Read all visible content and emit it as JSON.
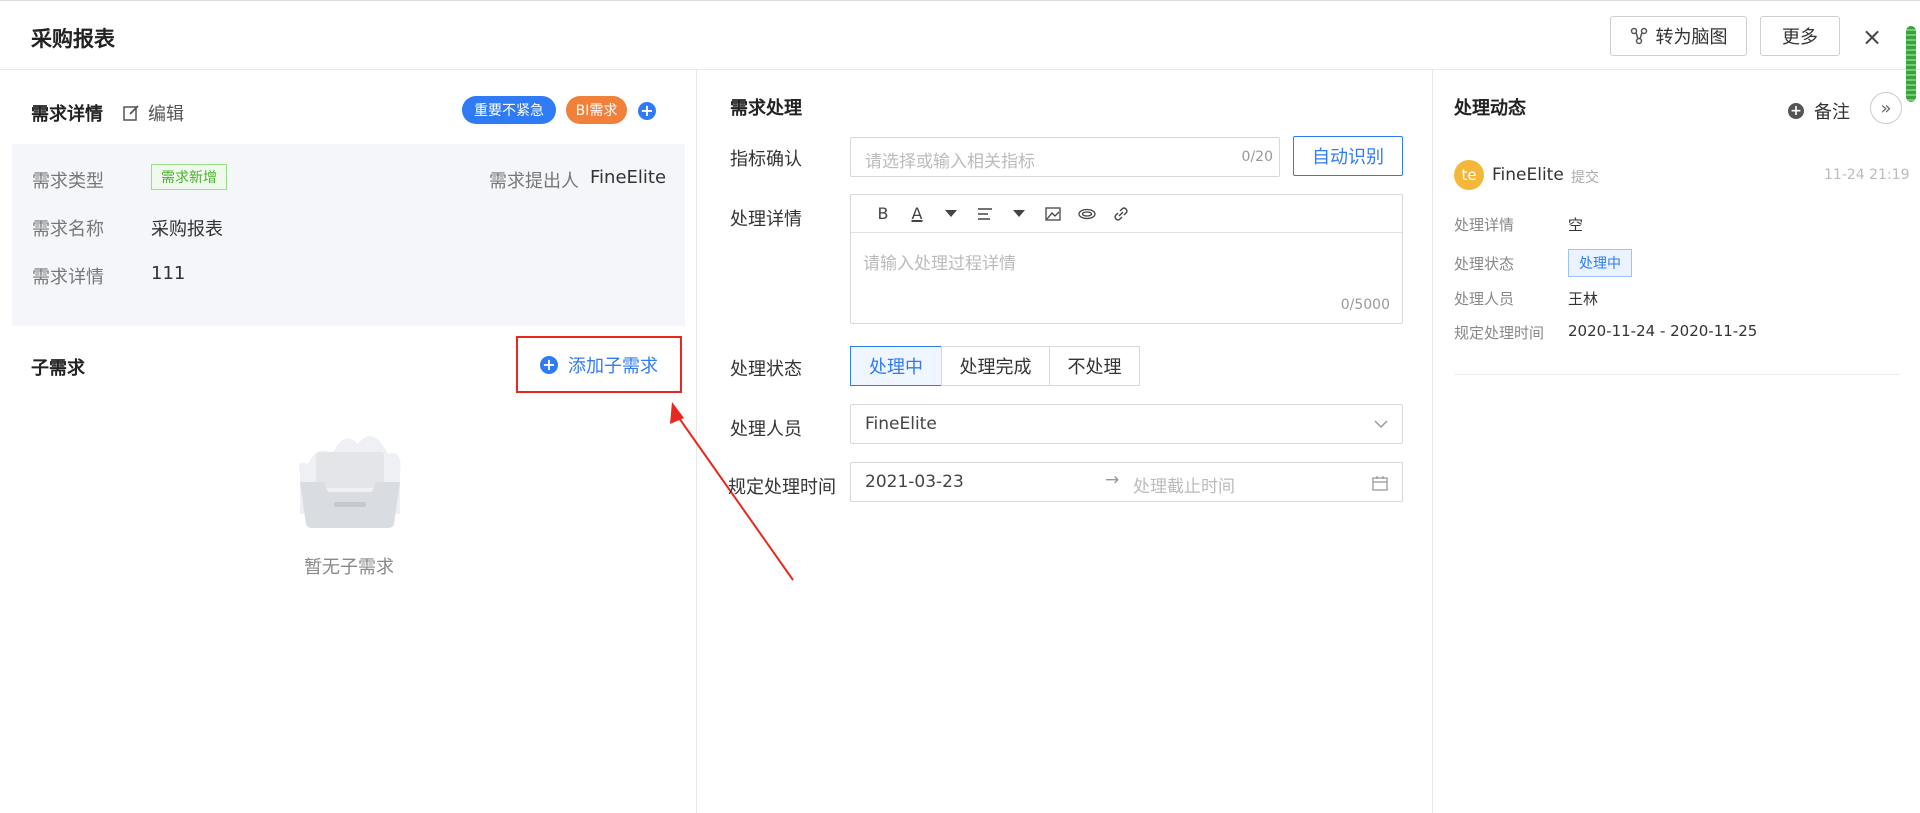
{
  "header": {
    "title": "采购报表",
    "mindmap_label": "转为脑图",
    "more_label": "更多",
    "close_label": "×"
  },
  "left": {
    "details_title": "需求详情",
    "edit_label": "编辑",
    "tags": [
      "重要不紧急",
      "BI需求"
    ],
    "add_tag": "+",
    "fields": [
      {
        "key": "需求类型",
        "tag": "需求新增"
      },
      {
        "key": "需求名称",
        "value": "采购报表"
      },
      {
        "key": "需求详情",
        "value": "111"
      }
    ],
    "submitter_key": "需求提出人",
    "submitter_value": "FineElite",
    "sub_title": "子需求",
    "add_sub_label": "添加子需求",
    "add_sub_icon": "+",
    "empty_text": "暂无子需求"
  },
  "middle": {
    "title": "需求处理",
    "metric_label": "指标确认",
    "metric_placeholder": "请选择或输入相关指标",
    "metric_counter": "0/20",
    "auto_label": "自动识别",
    "detail_label": "处理详情",
    "detail_placeholder": "请输入处理过程详情",
    "detail_counter": "0/5000",
    "toolbar": {
      "bold": "B",
      "font_color": "A"
    },
    "status_label": "处理状态",
    "status_options": [
      "处理中",
      "处理完成",
      "不处理"
    ],
    "status_selected": "处理中",
    "handler_label": "处理人员",
    "handler_value": "FineElite",
    "time_label": "规定处理时间",
    "time_start": "2021-03-23",
    "time_end_placeholder": "处理截止时间"
  },
  "right": {
    "title": "处理动态",
    "note_label": "备注",
    "note_icon": "+",
    "expand_icon": "»",
    "activity": {
      "avatar": "te",
      "user": "FineElite",
      "action": "提交",
      "time": "11-24 21:19",
      "rows": [
        {
          "key": "处理详情",
          "value": "空"
        },
        {
          "key": "处理状态",
          "tag": "处理中"
        },
        {
          "key": "处理人员",
          "value": "王林"
        },
        {
          "key": "规定处理时间",
          "value": "2020-11-24 - 2020-11-25"
        }
      ]
    }
  },
  "colors": {
    "accent": "#2f7bf5",
    "orange": "#f0803a",
    "annotation": "#e8281e"
  }
}
